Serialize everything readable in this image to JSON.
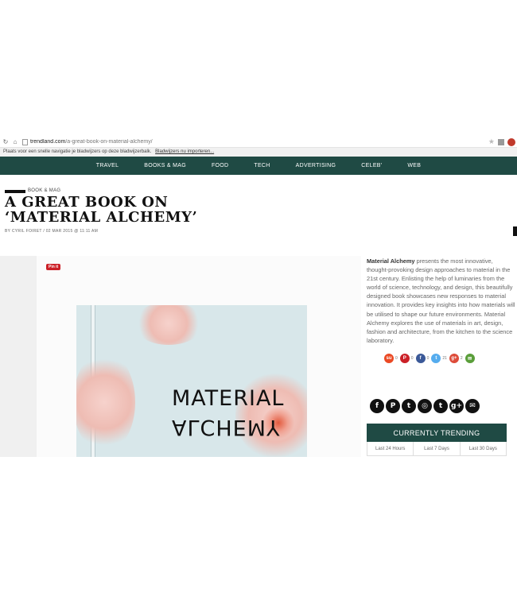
{
  "browser": {
    "url_host": "trendland.com",
    "url_path": "/a-great-book-on-material-alchemy/",
    "bookmark_text": "Plaats voor een snelle navigatie je bladwijzers op deze bladwijzerbalk.",
    "bookmark_import": "Bladwijzers nu importeren..."
  },
  "nav": {
    "items": [
      "TRAVEL",
      "BOOKS & MAG",
      "FOOD",
      "TECH",
      "ADVERTISING",
      "CELEB'",
      "WEB"
    ]
  },
  "article": {
    "category": "BOOK & MAG",
    "title": "A GREAT BOOK ON ‘MATERIAL ALCHEMY’",
    "byline": "BY CYRIL FOIRET  /  02 MAR 2015 @ 11:11 AM"
  },
  "hero": {
    "pin_label": "Pin it",
    "book_title_line1": "MATERIAL",
    "book_title_line2": "ALCHEMY"
  },
  "sidebar": {
    "description_bold": "Material Alchemy",
    "description_rest": " presents the most innovative, thought-provoking design approaches to material in the 21st century. Enlisting the help of luminaries from the world of science, technology, and design, this beautifully designed book showcases new responses to material innovation. It provides key insights into how materials will be utilised to shape our future environments. Material Alchemy explores the use of materials in art, design, fashion and architecture, from the kitchen to the science laboratory.",
    "shares": [
      {
        "icon": "stumbleupon-icon",
        "glyph": "su",
        "color": "#eb4924",
        "count": "0"
      },
      {
        "icon": "pinterest-icon",
        "glyph": "P",
        "color": "#cb2027",
        "count": "0"
      },
      {
        "icon": "facebook-icon",
        "glyph": "f",
        "color": "#3b5998",
        "count": "0"
      },
      {
        "icon": "twitter-icon",
        "glyph": "t",
        "color": "#55acee",
        "count": "21"
      },
      {
        "icon": "googleplus-icon",
        "glyph": "g+",
        "color": "#dd4b39",
        "count": "2"
      },
      {
        "icon": "email-icon",
        "glyph": "✉",
        "color": "#5a9e3a",
        "count": ""
      }
    ],
    "socials": [
      {
        "icon": "facebook-icon",
        "glyph": "f"
      },
      {
        "icon": "pinterest-icon",
        "glyph": "P"
      },
      {
        "icon": "twitter-icon",
        "glyph": "t"
      },
      {
        "icon": "instagram-icon",
        "glyph": "◎"
      },
      {
        "icon": "tumblr-icon",
        "glyph": "t"
      },
      {
        "icon": "googleplus-icon",
        "glyph": "g+"
      },
      {
        "icon": "email-icon",
        "glyph": "✉"
      }
    ],
    "trending_title": "CURRENTLY TRENDING",
    "trending_tabs": [
      "Last 24 Hours",
      "Last 7 Days",
      "Last 30 Days"
    ]
  },
  "colors": {
    "brand_teal": "#1f4a44"
  }
}
